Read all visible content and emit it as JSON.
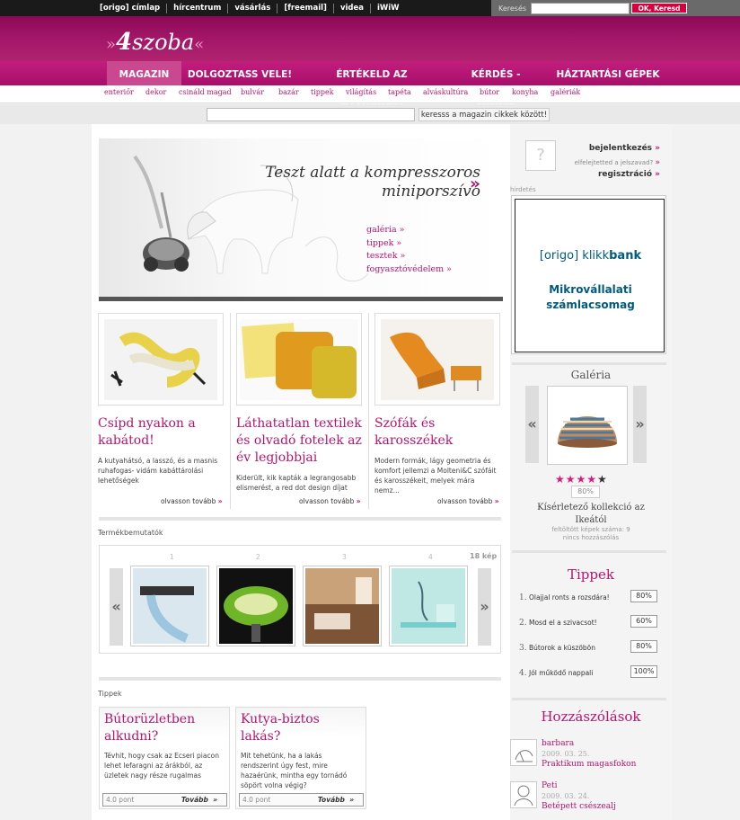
{
  "topbar": {
    "links": [
      "[origo] címlap",
      "hírcentrum",
      "vásárlás",
      "[freemail]",
      "videa",
      "iWiW"
    ],
    "search_label": "Keresés",
    "search_button": "OK, Keresd"
  },
  "logo": {
    "pre": "»",
    "brand_num": "4",
    "brand_text": "szoba",
    "post": "«"
  },
  "nav": {
    "items": [
      "MAGAZIN",
      "DOLGOZTASS VELE!",
      "ÉRTÉKELD AZ OTTHONOM",
      "KÉRDÉS - VÁLASZ",
      "HÁZTARTÁSI GÉPEK"
    ]
  },
  "subnav": {
    "items": [
      "enteriőr",
      "dekor",
      "csináld magad",
      "bulvár",
      "bazár",
      "tippek",
      "világítás",
      "tapéta",
      "alváskultúra",
      "bútor",
      "konyha",
      "galériák"
    ]
  },
  "magsearch": {
    "button": "keresss a magazin cikkek között!"
  },
  "hero": {
    "title_line1": "Teszt alatt a kompresszoros",
    "title_line2": "miniporszívó",
    "arrow": "»",
    "links": [
      "galéria »",
      "tippek »",
      "tesztek »",
      "fogyasztóvédelem »"
    ]
  },
  "articles": [
    {
      "title": "Csípd nyakon a kabátod!",
      "text": "A kutyahátsó, a lasszó, és a masnis ruhafogas- vidám kabáttárolási lehetőségek",
      "more": "olvasson tovább"
    },
    {
      "title": "Láthatatlan textilek és olvadó fotelek az év legjobbjai",
      "text": "Kiderült, kik kapták a legrangosabb elismerést, a red dot design díjat",
      "more": "olvasson tovább"
    },
    {
      "title": "Szófák és karosszékek",
      "text": "Modern formák, lágy geometria és komfort jellemzi a Molteni&C szófáit és karosszékeit, melyek mára nemz...",
      "more": "olvasson tovább"
    }
  ],
  "products": {
    "section_title": "Termékbemutatók",
    "count": "18 kép",
    "numbers": [
      "1",
      "2",
      "3",
      "4"
    ],
    "prev": "«",
    "next": "»"
  },
  "tips_section": {
    "title": "Tippek",
    "cards": [
      {
        "title": "Bútorüzletben alkudni?",
        "text": "Tévhit, hogy csak az Ecseri piacon lehet lefaragni az árákból, az üzletek nagy része rugalmas",
        "points": "4.0 pont",
        "more": "Tovább"
      },
      {
        "title": "Kutya-biztos lakás?",
        "text": "Mit tehetünk, ha a lakás rendszerint úgy fest, mire hazaérünk, mintha egy tornádó söpört volna végig?",
        "points": "4.0 pont",
        "more": "Tovább"
      }
    ]
  },
  "login": {
    "login": "bejelentkezés",
    "forgot": "elfelejtetted a jelszavad?",
    "register": "regisztráció",
    "arrow": "»",
    "avatar": "?"
  },
  "ad": {
    "label": "hirdetés",
    "brand_a": "[origo]",
    "brand_b": "klikk",
    "brand_c": "bank",
    "line1": "Mikrovállalati",
    "line2": "számlacsomag"
  },
  "gallery": {
    "title": "Galéria",
    "prev": "«",
    "next": "»",
    "rating": "80%",
    "stars_on": "★★★★",
    "stars_off": "★",
    "caption_line1": "Kísérletező kollekció az",
    "caption_line2": "Ikeától",
    "info_line1": "feltöltött képek száma: 9",
    "info_line2": "nincs hozzászólás"
  },
  "side_tips": {
    "title": "Tippek",
    "items": [
      {
        "num": "1.",
        "text": "Olajjal ronts a rozsdára!",
        "pct": "80%"
      },
      {
        "num": "2.",
        "text": "Mosd el a szivacsot!",
        "pct": "60%"
      },
      {
        "num": "3.",
        "text": "Bútorok a küszöbön",
        "pct": "80%"
      },
      {
        "num": "4.",
        "text": "Jól működő nappali",
        "pct": "100%"
      }
    ]
  },
  "comments": {
    "title": "Hozzászólások",
    "items": [
      {
        "user": "barbara",
        "date": "2009. 03. 25.",
        "text": "Praktikum magasfokon"
      },
      {
        "user": "Peti",
        "date": "2009. 03. 24.",
        "text": "Betépett csészealj"
      }
    ]
  },
  "colors": {
    "accent": "#b5156d",
    "nav_bg": "#c21e7e",
    "header_bg": "#a41669"
  }
}
